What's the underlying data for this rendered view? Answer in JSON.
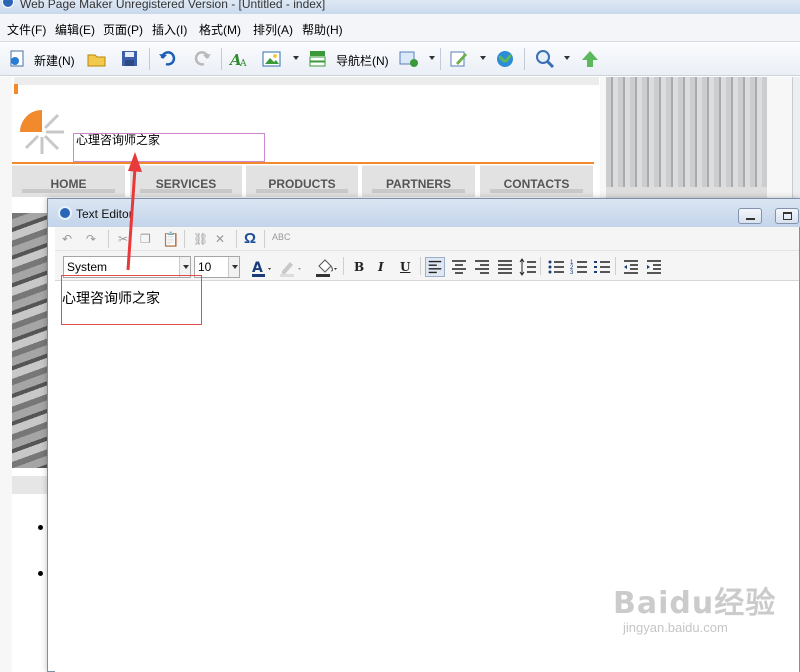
{
  "window": {
    "title": "Web Page Maker Unregistered Version - [Untitled - index]"
  },
  "menu": [
    "文件(F)",
    "编辑(E)",
    "页面(P)",
    "插入(I)",
    "格式(M)",
    "排列(A)",
    "帮助(H)"
  ],
  "toolbar": {
    "new_label": "新建(N)",
    "navbar_label": "导航栏(N)"
  },
  "page": {
    "textbox_text": "心理咨询师之家",
    "nav_items": [
      "HOME",
      "SERVICES",
      "PRODUCTS",
      "PARTNERS",
      "CONTACTS"
    ]
  },
  "editor": {
    "title": "Text Editor",
    "font": "System",
    "size": "10",
    "content": "心理咨询师之家",
    "bold": "B",
    "italic": "I",
    "underline": "U",
    "omega": "Ω"
  },
  "watermark": {
    "brand": "Baidu经验",
    "url": "jingyan.baidu.com"
  }
}
